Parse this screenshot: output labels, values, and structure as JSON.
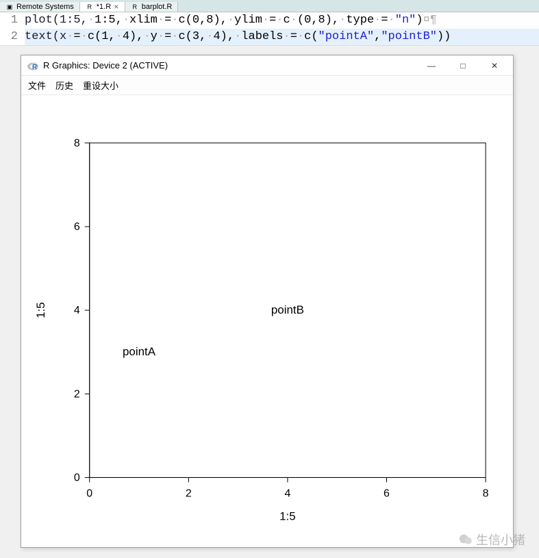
{
  "tabs": {
    "remote": "Remote Systems",
    "r1": "*1.R",
    "r1_close": "✕",
    "barplot": "barplot.R"
  },
  "code": {
    "line1_num": "1",
    "line2_num": "2",
    "l1": {
      "a": "plot(1:5,",
      "b": "1:5,",
      "c": "xlim",
      "d": "=",
      "e": "c(0,8),",
      "f": "ylim",
      "g": "=",
      "h": "c",
      "i": "(0,8),",
      "j": "type",
      "k": "=",
      "l": "\"n\"",
      "m": ")"
    },
    "l2": {
      "a": "text(x",
      "b": "=",
      "c": "c(1,",
      "d": "4),",
      "e": "y",
      "f": "=",
      "g": "c(3,",
      "h": "4),",
      "i": "labels",
      "j": "=",
      "k": "c(",
      "l": "\"pointA\"",
      "m": ",",
      "n": "\"pointB\"",
      "o": "))"
    }
  },
  "window": {
    "title": "R Graphics: Device 2 (ACTIVE)",
    "menu": {
      "file": "文件",
      "history": "历史",
      "resize": "重设大小"
    },
    "min": "—",
    "max": "□",
    "close": "✕"
  },
  "chart_data": {
    "type": "scatter",
    "title": "",
    "xlabel": "1:5",
    "ylabel": "1:5",
    "xlim": [
      0,
      8
    ],
    "ylim": [
      0,
      8
    ],
    "x_ticks": [
      0,
      2,
      4,
      6,
      8
    ],
    "y_ticks": [
      0,
      2,
      4,
      6,
      8
    ],
    "points": [
      {
        "x": 1,
        "y": 3,
        "label": "pointA"
      },
      {
        "x": 4,
        "y": 4,
        "label": "pointB"
      }
    ]
  },
  "watermark": {
    "text": "生信小猪"
  }
}
